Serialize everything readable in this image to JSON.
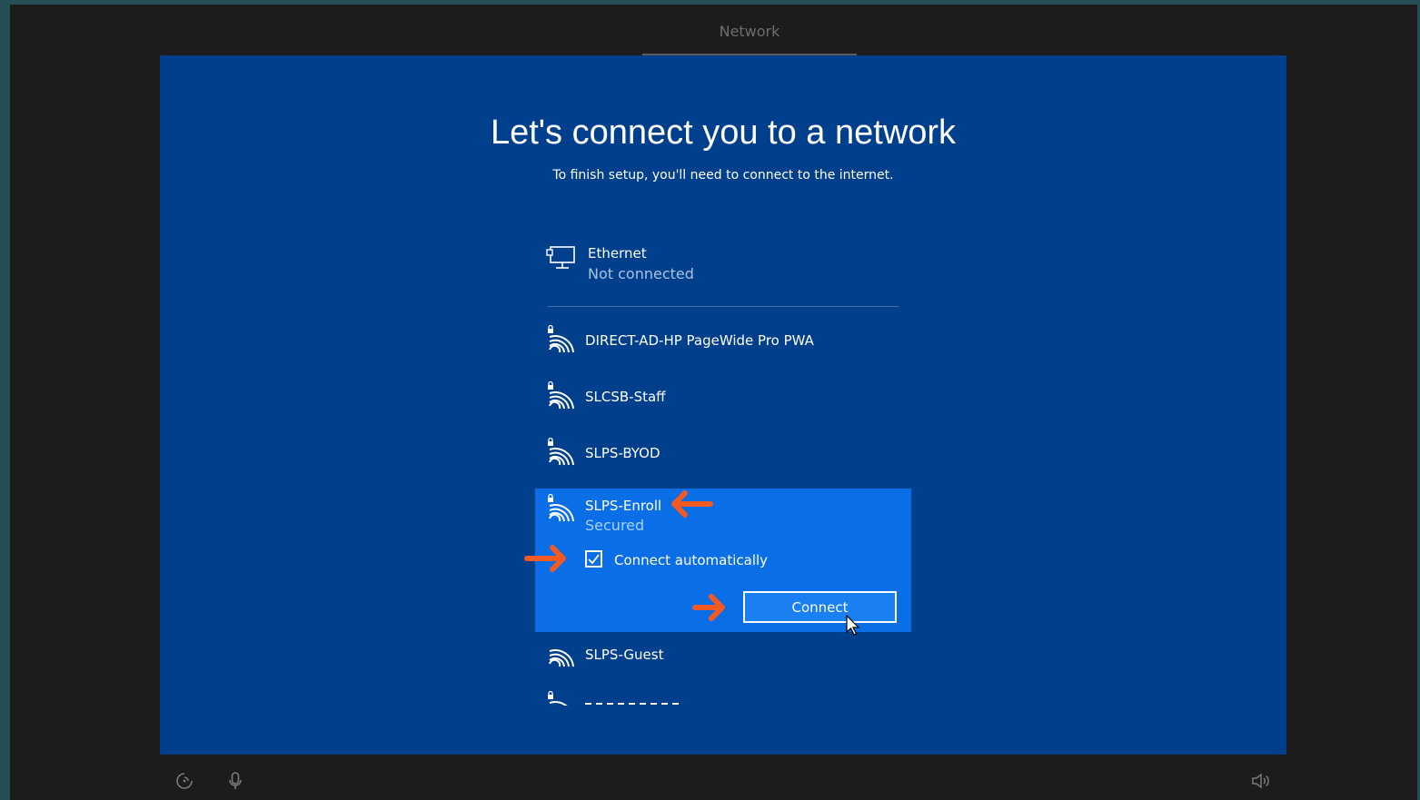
{
  "top_tab": {
    "label": "Network"
  },
  "page": {
    "title": "Let's connect you to a network",
    "subtitle": "To finish setup, you'll need to connect to the internet."
  },
  "ethernet": {
    "name": "Ethernet",
    "status": "Not connected",
    "icon": "ethernet-icon"
  },
  "networks": [
    {
      "name": "DIRECT-AD-HP PageWide Pro PWA",
      "secured": true
    },
    {
      "name": "SLCSB-Staff",
      "secured": true
    },
    {
      "name": "SLPS-BYOD",
      "secured": true
    },
    {
      "name": "SLPS-Enroll",
      "secured": true,
      "status": "Secured",
      "selected": true
    },
    {
      "name": "SLPS-Guest",
      "secured": false
    }
  ],
  "selected_network": {
    "name": "SLPS-Enroll",
    "status": "Secured",
    "auto_connect_label": "Connect automatically",
    "auto_connect_checked": true,
    "connect_label": "Connect"
  },
  "colors": {
    "panel_bg": "#003f8c",
    "selected_bg": "#0a6ee6",
    "annotation_arrow": "#f15a22"
  },
  "bottom_bar": {
    "left_icons": [
      "ease-of-access-icon",
      "microphone-icon"
    ],
    "right_icons": [
      "volume-icon"
    ]
  }
}
